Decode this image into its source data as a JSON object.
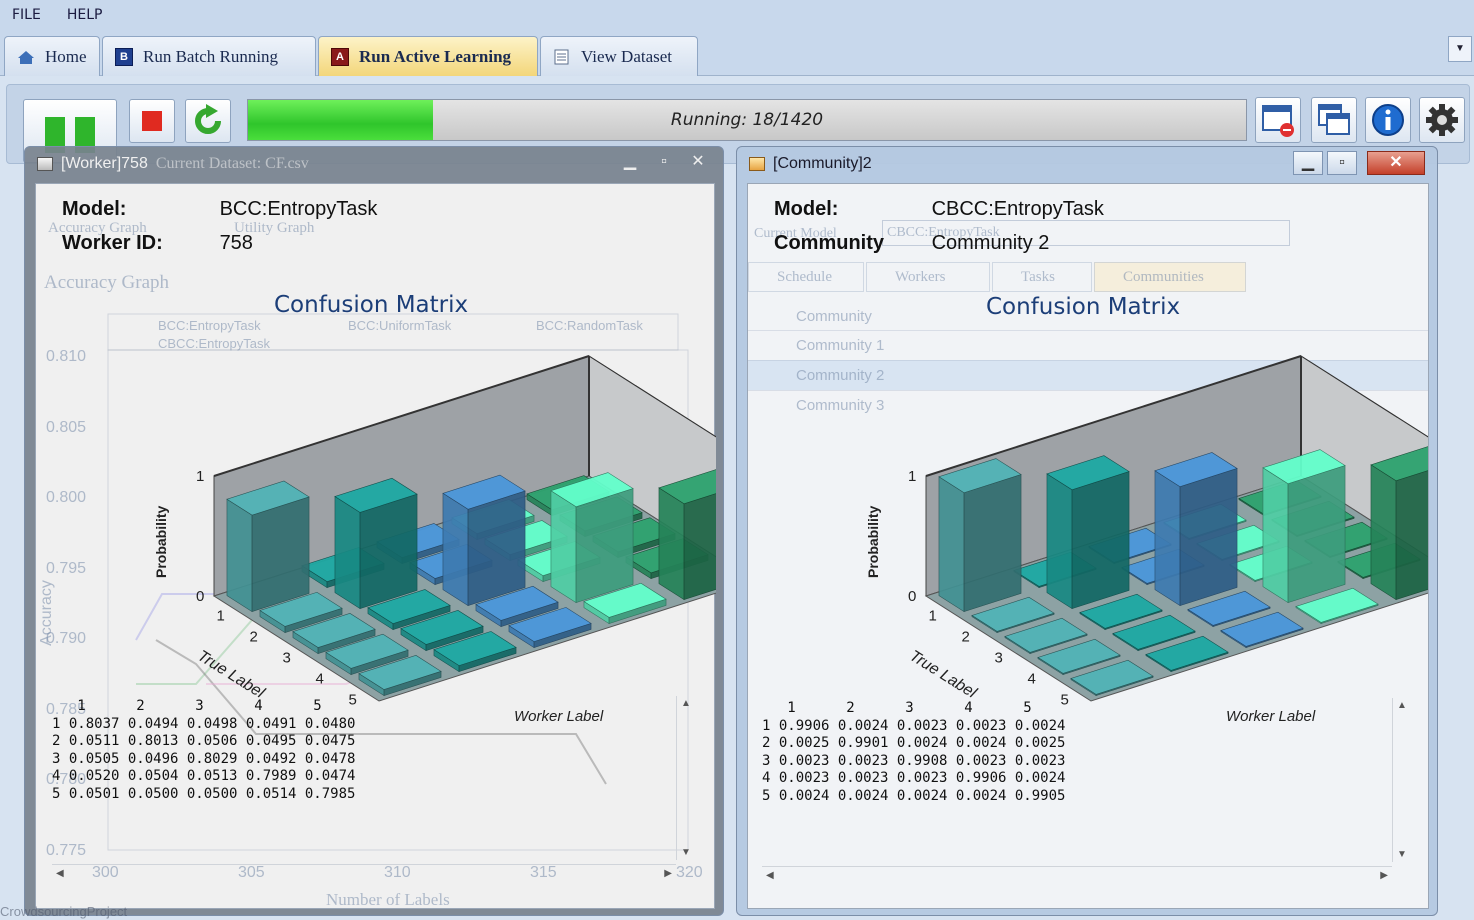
{
  "menu": [
    "FILE",
    "HELP"
  ],
  "tabs": [
    {
      "label": "Home",
      "active": false
    },
    {
      "label": "Run Batch Running",
      "active": false
    },
    {
      "label": "Run Active Learning",
      "active": true
    },
    {
      "label": "View Dataset",
      "active": false
    }
  ],
  "toolbar": {
    "progress_text": "Running: 18/1420",
    "progress_fraction": 0.185
  },
  "background_ghosts": {
    "dataset": "Current Dataset: CF.csv",
    "accuracy_tab": "Accuracy Graph",
    "utility_tab": "Utility Graph",
    "accuracy_title": "Accuracy Graph",
    "legend": [
      "BCC:EntropyTask",
      "BCC:UniformTask",
      "BCC:RandomTask",
      "CBCC:EntropyTask"
    ],
    "yaxis_ticks": [
      "0.810",
      "0.805",
      "0.800",
      "0.795",
      "0.790",
      "0.785",
      "0.780",
      "0.775"
    ],
    "xaxis_ticks": [
      "300",
      "305",
      "310",
      "315",
      "320"
    ],
    "ylabel": "Accuracy",
    "xlabel": "Number of Labels",
    "current_model_label": "Current Model",
    "current_model_value": "CBCC:EntropyTask",
    "sub_tabs": [
      "Schedule",
      "Workers",
      "Tasks",
      "Communities"
    ],
    "community_header": "Community",
    "community_rows": [
      "Community 1",
      "Community 2",
      "Community 3"
    ],
    "status": "CrowdsourcingProject"
  },
  "left_window": {
    "title": "[Worker]758",
    "model_label": "Model:",
    "model_value": "BCC:EntropyTask",
    "id_label": "Worker ID:",
    "id_value": "758",
    "chart_title": "Confusion Matrix",
    "matrix_header": [
      "1",
      "2",
      "3",
      "4",
      "5"
    ],
    "matrix_rows": [
      [
        "1",
        "0.8037",
        "0.0494",
        "0.0498",
        "0.0491",
        "0.0480"
      ],
      [
        "2",
        "0.0511",
        "0.8013",
        "0.0506",
        "0.0495",
        "0.0475"
      ],
      [
        "3",
        "0.0505",
        "0.0496",
        "0.8029",
        "0.0492",
        "0.0478"
      ],
      [
        "4",
        "0.0520",
        "0.0504",
        "0.0513",
        "0.7989",
        "0.0474"
      ],
      [
        "5",
        "0.0501",
        "0.0500",
        "0.0500",
        "0.0514",
        "0.7985"
      ]
    ]
  },
  "right_window": {
    "title": "[Community]2",
    "model_label": "Model:",
    "model_value": "CBCC:EntropyTask",
    "id_label": "Community",
    "id_value": "Community 2",
    "chart_title": "Confusion Matrix",
    "matrix_header": [
      "1",
      "2",
      "3",
      "4",
      "5"
    ],
    "matrix_rows": [
      [
        "1",
        "0.9906",
        "0.0024",
        "0.0023",
        "0.0023",
        "0.0024"
      ],
      [
        "2",
        "0.0025",
        "0.9901",
        "0.0024",
        "0.0024",
        "0.0025"
      ],
      [
        "3",
        "0.0023",
        "0.0023",
        "0.9908",
        "0.0023",
        "0.0023"
      ],
      [
        "4",
        "0.0023",
        "0.0023",
        "0.0023",
        "0.9906",
        "0.0024"
      ],
      [
        "5",
        "0.0024",
        "0.0024",
        "0.0024",
        "0.0024",
        "0.9905"
      ]
    ]
  },
  "chart_data": [
    {
      "type": "bar",
      "title": "Confusion Matrix",
      "xlabel": "True Label",
      "ylabel": "Probability",
      "zlabel": "Worker Label",
      "categories": [
        "1",
        "2",
        "3",
        "4",
        "5"
      ],
      "yticks": [
        "0",
        "1"
      ],
      "series": [
        {
          "name": "1",
          "values": [
            0.8037,
            0.0494,
            0.0498,
            0.0491,
            0.048
          ]
        },
        {
          "name": "2",
          "values": [
            0.0511,
            0.8013,
            0.0506,
            0.0495,
            0.0475
          ]
        },
        {
          "name": "3",
          "values": [
            0.0505,
            0.0496,
            0.8029,
            0.0492,
            0.0478
          ]
        },
        {
          "name": "4",
          "values": [
            0.052,
            0.0504,
            0.0513,
            0.7989,
            0.0474
          ]
        },
        {
          "name": "5",
          "values": [
            0.0501,
            0.05,
            0.05,
            0.0514,
            0.7985
          ]
        }
      ],
      "colors": [
        "#3f8a8c",
        "#17827d",
        "#3a74a8",
        "#4cc49c",
        "#237d55"
      ]
    },
    {
      "type": "bar",
      "title": "Confusion Matrix",
      "xlabel": "True Label",
      "ylabel": "Probability",
      "zlabel": "Worker Label",
      "categories": [
        "1",
        "2",
        "3",
        "4",
        "5"
      ],
      "yticks": [
        "0",
        "1"
      ],
      "series": [
        {
          "name": "1",
          "values": [
            0.9906,
            0.0024,
            0.0023,
            0.0023,
            0.0024
          ]
        },
        {
          "name": "2",
          "values": [
            0.0025,
            0.9901,
            0.0024,
            0.0024,
            0.0025
          ]
        },
        {
          "name": "3",
          "values": [
            0.0023,
            0.0023,
            0.9908,
            0.0023,
            0.0023
          ]
        },
        {
          "name": "4",
          "values": [
            0.0023,
            0.0023,
            0.0023,
            0.9906,
            0.0024
          ]
        },
        {
          "name": "5",
          "values": [
            0.0024,
            0.0024,
            0.0024,
            0.0024,
            0.9905
          ]
        }
      ],
      "colors": [
        "#3f8a8c",
        "#17827d",
        "#3a74a8",
        "#4cc49c",
        "#237d55"
      ]
    }
  ]
}
